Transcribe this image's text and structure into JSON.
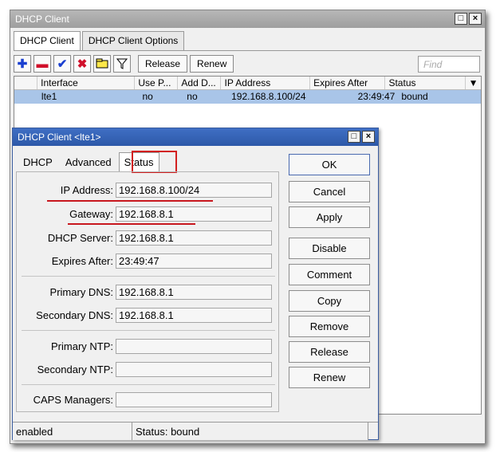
{
  "main": {
    "title": "DHCP Client",
    "tabs": [
      {
        "label": "DHCP Client",
        "active": true
      },
      {
        "label": "DHCP Client Options",
        "active": false
      }
    ],
    "toolbar": {
      "release_label": "Release",
      "renew_label": "Renew",
      "find_placeholder": "Find"
    },
    "columns": [
      "",
      "Interface",
      "Use P...",
      "Add D...",
      "IP Address",
      "Expires After",
      "Status"
    ],
    "rows": [
      {
        "interface": "lte1",
        "use_peer": "no",
        "add_default": "no",
        "ip": "192.168.8.100/24",
        "expires": "23:49:47",
        "status": "bound"
      }
    ]
  },
  "dialog": {
    "title": "DHCP Client <lte1>",
    "tabs": [
      {
        "label": "DHCP"
      },
      {
        "label": "Advanced"
      },
      {
        "label": "Status"
      }
    ],
    "fields": {
      "ip_address_label": "IP Address:",
      "ip_address": "192.168.8.100/24",
      "gateway_label": "Gateway:",
      "gateway": "192.168.8.1",
      "dhcp_server_label": "DHCP Server:",
      "dhcp_server": "192.168.8.1",
      "expires_after_label": "Expires After:",
      "expires_after": "23:49:47",
      "primary_dns_label": "Primary DNS:",
      "primary_dns": "192.168.8.1",
      "secondary_dns_label": "Secondary DNS:",
      "secondary_dns": "192.168.8.1",
      "primary_ntp_label": "Primary NTP:",
      "primary_ntp": "",
      "secondary_ntp_label": "Secondary NTP:",
      "secondary_ntp": "",
      "caps_managers_label": "CAPS Managers:",
      "caps_managers": ""
    },
    "buttons": {
      "ok": "OK",
      "cancel": "Cancel",
      "apply": "Apply",
      "disable": "Disable",
      "comment": "Comment",
      "copy": "Copy",
      "remove": "Remove",
      "release": "Release",
      "renew": "Renew"
    },
    "status_bar": {
      "left": "enabled",
      "right": "Status: bound"
    }
  },
  "colors": {
    "selected_row": "#a9c5e8",
    "dialog_title": "#2d58a8",
    "highlight": "#d21f1f"
  },
  "icons": [
    "add-icon",
    "remove-icon",
    "check-icon",
    "x-icon",
    "comment-icon",
    "filter-icon"
  ]
}
